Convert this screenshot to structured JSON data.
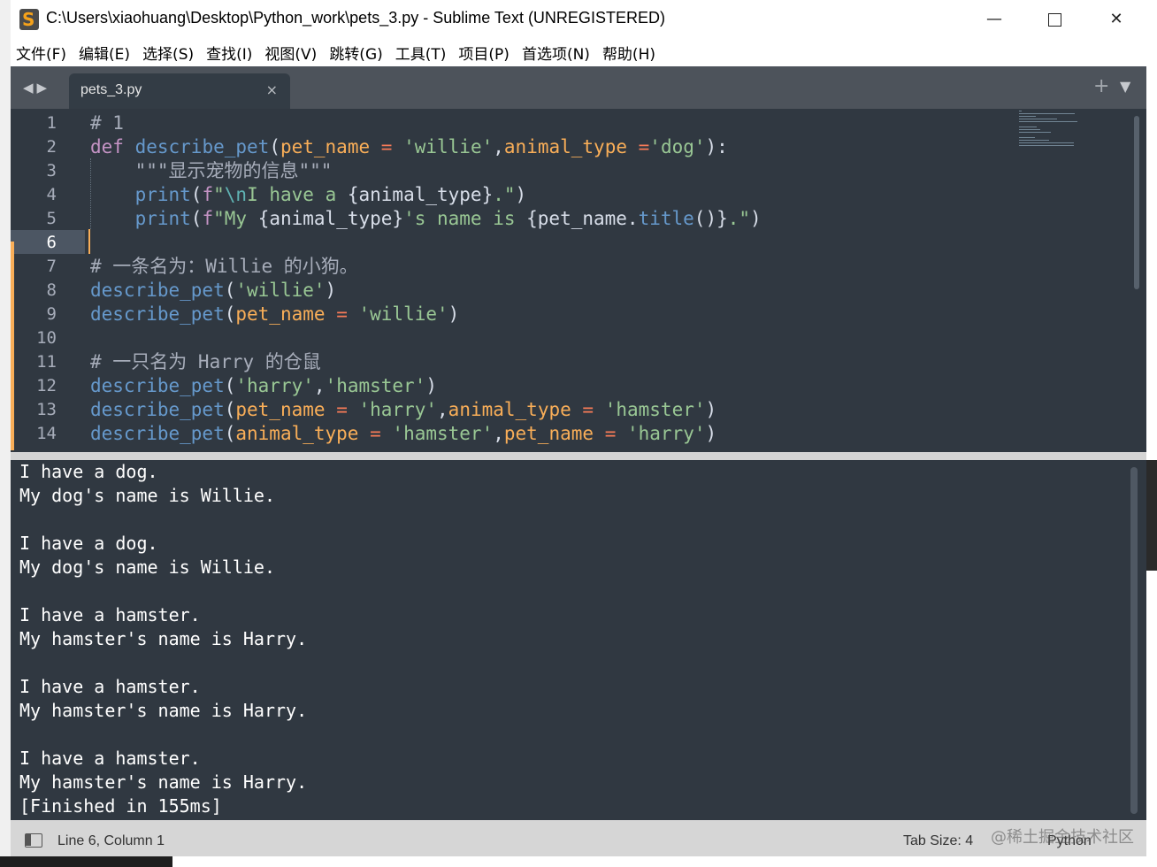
{
  "window": {
    "title": "C:\\Users\\xiaohuang\\Desktop\\Python_work\\pets_3.py - Sublime Text (UNREGISTERED)",
    "minimize_glyph": "—",
    "close_glyph": "✕"
  },
  "menu": [
    "文件(F)",
    "编辑(E)",
    "选择(S)",
    "查找(I)",
    "视图(V)",
    "跳转(G)",
    "工具(T)",
    "项目(P)",
    "首选项(N)",
    "帮助(H)"
  ],
  "tabs": {
    "nav_arrows": "◀▶",
    "active": {
      "title": "pets_3.py",
      "close": "×"
    },
    "plus": "+",
    "dropdown": "▼"
  },
  "editor": {
    "current_line": 6,
    "line_numbers": [
      "1",
      "2",
      "3",
      "4",
      "5",
      "6",
      "7",
      "8",
      "9",
      "10",
      "11",
      "12",
      "13",
      "14"
    ],
    "code": [
      [
        {
          "t": "# 1",
          "c": "cm"
        }
      ],
      [
        {
          "t": "def",
          "c": "kw"
        },
        {
          "t": " ",
          "c": "pl"
        },
        {
          "t": "describe_pet",
          "c": "fn"
        },
        {
          "t": "(",
          "c": "pl"
        },
        {
          "t": "pet_name",
          "c": "pm"
        },
        {
          "t": " ",
          "c": "pl"
        },
        {
          "t": "=",
          "c": "op"
        },
        {
          "t": " ",
          "c": "pl"
        },
        {
          "t": "'willie'",
          "c": "st"
        },
        {
          "t": ",",
          "c": "pl"
        },
        {
          "t": "animal_type",
          "c": "pm"
        },
        {
          "t": " ",
          "c": "pl"
        },
        {
          "t": "=",
          "c": "op"
        },
        {
          "t": "'dog'",
          "c": "st"
        },
        {
          "t": "):",
          "c": "pl"
        }
      ],
      [
        {
          "t": "    \"\"\"显示宠物的信息\"\"\"",
          "c": "cm"
        }
      ],
      [
        {
          "t": "    ",
          "c": "pl"
        },
        {
          "t": "print",
          "c": "bi"
        },
        {
          "t": "(",
          "c": "pl"
        },
        {
          "t": "f",
          "c": "kw"
        },
        {
          "t": "\"",
          "c": "st"
        },
        {
          "t": "\\n",
          "c": "esc"
        },
        {
          "t": "I have a ",
          "c": "st"
        },
        {
          "t": "{animal_type}",
          "c": "pl"
        },
        {
          "t": ".\"",
          "c": "st"
        },
        {
          "t": ")",
          "c": "pl"
        }
      ],
      [
        {
          "t": "    ",
          "c": "pl"
        },
        {
          "t": "print",
          "c": "bi"
        },
        {
          "t": "(",
          "c": "pl"
        },
        {
          "t": "f",
          "c": "kw"
        },
        {
          "t": "\"My ",
          "c": "st"
        },
        {
          "t": "{animal_type}",
          "c": "pl"
        },
        {
          "t": "'s name is ",
          "c": "st"
        },
        {
          "t": "{pet_name.",
          "c": "pl"
        },
        {
          "t": "title",
          "c": "fn"
        },
        {
          "t": "()}",
          "c": "pl"
        },
        {
          "t": ".\"",
          "c": "st"
        },
        {
          "t": ")",
          "c": "pl"
        }
      ],
      [
        {
          "t": "",
          "c": "pl"
        }
      ],
      [
        {
          "t": "# 一条名为：Willie 的小狗。",
          "c": "cm"
        }
      ],
      [
        {
          "t": "describe_pet",
          "c": "fn"
        },
        {
          "t": "(",
          "c": "pl"
        },
        {
          "t": "'willie'",
          "c": "st"
        },
        {
          "t": ")",
          "c": "pl"
        }
      ],
      [
        {
          "t": "describe_pet",
          "c": "fn"
        },
        {
          "t": "(",
          "c": "pl"
        },
        {
          "t": "pet_name",
          "c": "pm"
        },
        {
          "t": " ",
          "c": "pl"
        },
        {
          "t": "=",
          "c": "op"
        },
        {
          "t": " ",
          "c": "pl"
        },
        {
          "t": "'willie'",
          "c": "st"
        },
        {
          "t": ")",
          "c": "pl"
        }
      ],
      [
        {
          "t": "",
          "c": "pl"
        }
      ],
      [
        {
          "t": "# 一只名为 Harry 的仓鼠",
          "c": "cm"
        }
      ],
      [
        {
          "t": "describe_pet",
          "c": "fn"
        },
        {
          "t": "(",
          "c": "pl"
        },
        {
          "t": "'harry'",
          "c": "st"
        },
        {
          "t": ",",
          "c": "pl"
        },
        {
          "t": "'hamster'",
          "c": "st"
        },
        {
          "t": ")",
          "c": "pl"
        }
      ],
      [
        {
          "t": "describe_pet",
          "c": "fn"
        },
        {
          "t": "(",
          "c": "pl"
        },
        {
          "t": "pet_name",
          "c": "pm"
        },
        {
          "t": " ",
          "c": "pl"
        },
        {
          "t": "=",
          "c": "op"
        },
        {
          "t": " ",
          "c": "pl"
        },
        {
          "t": "'harry'",
          "c": "st"
        },
        {
          "t": ",",
          "c": "pl"
        },
        {
          "t": "animal_type",
          "c": "pm"
        },
        {
          "t": " ",
          "c": "pl"
        },
        {
          "t": "=",
          "c": "op"
        },
        {
          "t": " ",
          "c": "pl"
        },
        {
          "t": "'hamster'",
          "c": "st"
        },
        {
          "t": ")",
          "c": "pl"
        }
      ],
      [
        {
          "t": "describe_pet",
          "c": "fn"
        },
        {
          "t": "(",
          "c": "pl"
        },
        {
          "t": "animal_type",
          "c": "pm"
        },
        {
          "t": " ",
          "c": "pl"
        },
        {
          "t": "=",
          "c": "op"
        },
        {
          "t": " ",
          "c": "pl"
        },
        {
          "t": "'hamster'",
          "c": "st"
        },
        {
          "t": ",",
          "c": "pl"
        },
        {
          "t": "pet_name",
          "c": "pm"
        },
        {
          "t": " ",
          "c": "pl"
        },
        {
          "t": "=",
          "c": "op"
        },
        {
          "t": " ",
          "c": "pl"
        },
        {
          "t": "'harry'",
          "c": "st"
        },
        {
          "t": ")",
          "c": "pl"
        }
      ]
    ]
  },
  "output": {
    "lines": [
      "I have a dog.",
      "My dog's name is Willie.",
      "",
      "I have a dog.",
      "My dog's name is Willie.",
      "",
      "I have a hamster.",
      "My hamster's name is Harry.",
      "",
      "I have a hamster.",
      "My hamster's name is Harry.",
      "",
      "I have a hamster.",
      "My hamster's name is Harry.",
      "[Finished in 155ms]"
    ]
  },
  "status": {
    "position": "Line 6, Column 1",
    "tab_size": "Tab Size: 4",
    "syntax": "Python",
    "watermark": "@稀土掘金技术社区"
  },
  "colors": {
    "editor_bg": "#303841",
    "accent": "#f9ae58",
    "keyword": "#c594c5",
    "function": "#6699cc",
    "string": "#99c794",
    "operator": "#f97b58",
    "comment": "#a7adba"
  }
}
